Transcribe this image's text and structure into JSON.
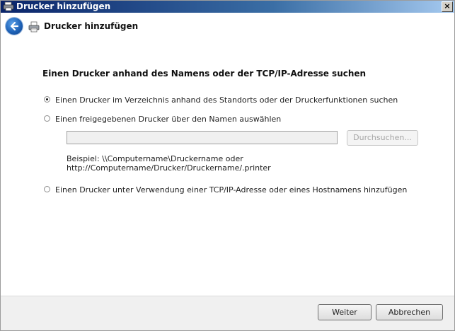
{
  "window": {
    "title": "Drucker hinzufügen",
    "close_label": "×"
  },
  "header": {
    "title": "Drucker hinzufügen"
  },
  "content": {
    "heading": "Einen Drucker anhand des Namens oder der TCP/IP-Adresse suchen",
    "options": [
      {
        "label": "Einen Drucker im Verzeichnis anhand des Standorts oder der Druckerfunktionen suchen",
        "selected": true
      },
      {
        "label": "Einen freigegebenen Drucker über den Namen auswählen",
        "selected": false
      },
      {
        "label": "Einen Drucker unter Verwendung einer TCP/IP-Adresse oder eines Hostnamens hinzufügen",
        "selected": false
      }
    ],
    "name_input": {
      "value": "",
      "placeholder": ""
    },
    "browse_button": "Durchsuchen...",
    "example_line1": "Beispiel: \\\\Computername\\Druckername oder",
    "example_line2": "http://Computername/Drucker/Druckername/.printer"
  },
  "footer": {
    "next_button": "Weiter",
    "cancel_button": "Abbrechen"
  }
}
